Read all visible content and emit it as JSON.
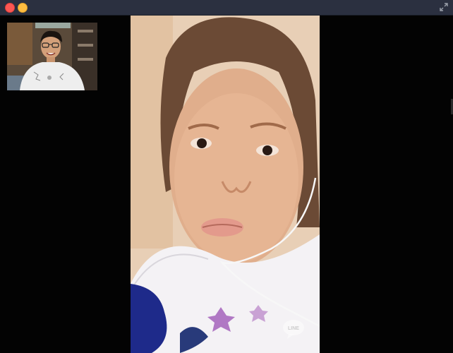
{
  "window": {
    "controls": [
      {
        "name": "close",
        "color": "#fc5753"
      },
      {
        "name": "minimize",
        "color": "#fdbc40"
      }
    ],
    "fullscreen_icon": "expand-arrows-icon",
    "titlebar_color": "#2b3040"
  },
  "call": {
    "remote_video": {
      "description_icon": "person-video-feed",
      "watermark_icon": "line-logo-icon"
    },
    "self_view": {
      "description_icon": "person-video-feed"
    }
  }
}
